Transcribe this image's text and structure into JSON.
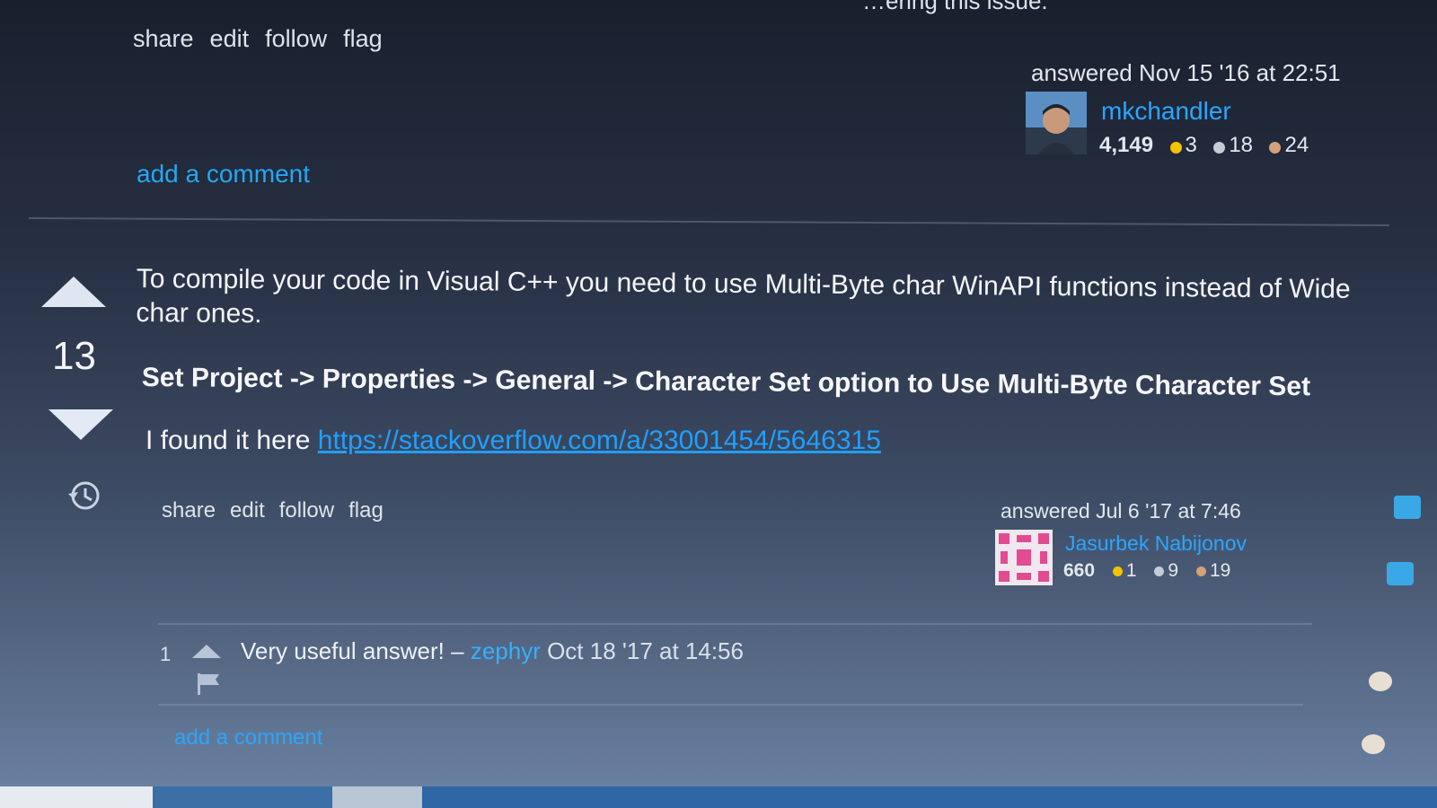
{
  "top_fragment": "…ering this issue.",
  "answer1": {
    "menu": [
      "share",
      "edit",
      "follow",
      "flag"
    ],
    "answered": "answered Nov 15 '16 at 22:51",
    "user": "mkchandler",
    "reputation": "4,149",
    "badges": {
      "gold": "3",
      "silver": "18",
      "bronze": "24"
    },
    "add_comment": "add a comment"
  },
  "answer2": {
    "votes": "13",
    "body": "To compile your code in Visual C++ you need to use Multi-Byte char WinAPI functions instead of Wide char ones.",
    "bold_line": "Set Project -> Properties -> General -> Character Set option to Use Multi-Byte Character Set",
    "found_prefix": "I found it here ",
    "found_link": "https://stackoverflow.com/a/33001454/5646315",
    "menu": [
      "share",
      "edit",
      "follow",
      "flag"
    ],
    "answered": "answered Jul 6 '17 at 7:46",
    "user": "Jasurbek Nabijonov",
    "reputation": "660",
    "badges": {
      "gold": "1",
      "silver": "9",
      "bronze": "19"
    },
    "comment": {
      "score": "1",
      "text": "Very useful answer! – ",
      "author": "zephyr",
      "time": " Oct 18 '17 at 14:56"
    },
    "add_comment": "add a comment"
  },
  "colors": {
    "link": "#1fa0ff",
    "gold": "#f4c300",
    "silver": "#c4ccd7",
    "bronze": "#d3a27a"
  },
  "icons": [
    "vote-up-icon",
    "vote-down-icon",
    "history-icon",
    "flag-icon"
  ]
}
